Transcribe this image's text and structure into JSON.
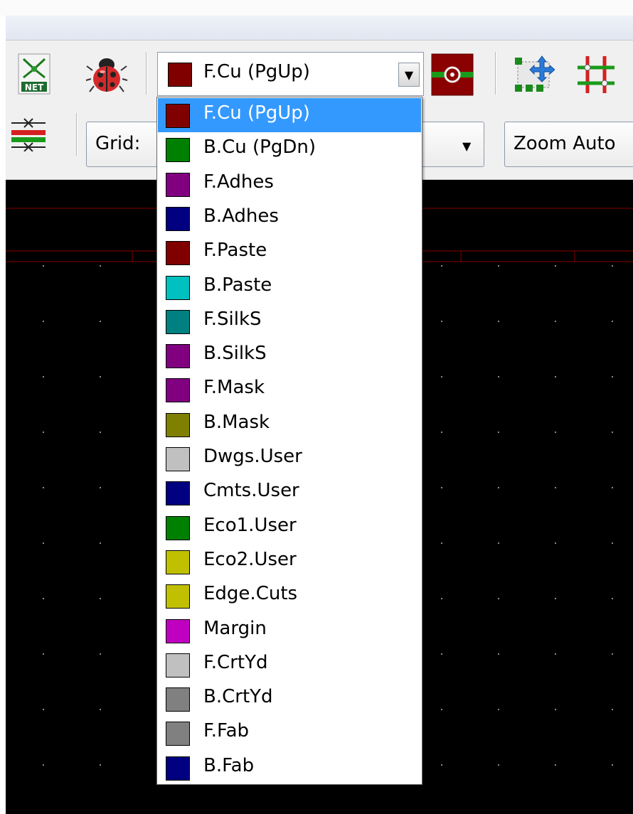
{
  "toolbar": {
    "layer_selector": {
      "value": "F.Cu (PgUp)",
      "swatch": "#800000"
    },
    "grid_label": "Grid:",
    "zoom_label": "Zoom Auto"
  },
  "icons": {
    "net": "NET",
    "netlist_icon": "netlist-icon",
    "drc_icon": "ladybug-drc-icon",
    "via_icon": "via-layer-pair-icon",
    "footprint_icon": "footprint-move-icon",
    "track_icon": "track-icon",
    "microwave_icon": "microwave-tool-icon"
  },
  "layers": [
    {
      "label": "F.Cu (PgUp)",
      "color": "#800000",
      "selected": true
    },
    {
      "label": "B.Cu (PgDn)",
      "color": "#008000"
    },
    {
      "label": "F.Adhes",
      "color": "#800080"
    },
    {
      "label": "B.Adhes",
      "color": "#000080"
    },
    {
      "label": "F.Paste",
      "color": "#800000"
    },
    {
      "label": "B.Paste",
      "color": "#00c0c0"
    },
    {
      "label": "F.SilkS",
      "color": "#008080"
    },
    {
      "label": "B.SilkS",
      "color": "#800080"
    },
    {
      "label": "F.Mask",
      "color": "#800080"
    },
    {
      "label": "B.Mask",
      "color": "#808000"
    },
    {
      "label": "Dwgs.User",
      "color": "#c0c0c0"
    },
    {
      "label": "Cmts.User",
      "color": "#000080"
    },
    {
      "label": "Eco1.User",
      "color": "#008000"
    },
    {
      "label": "Eco2.User",
      "color": "#c0c000"
    },
    {
      "label": "Edge.Cuts",
      "color": "#c0c000"
    },
    {
      "label": "Margin",
      "color": "#c000c0"
    },
    {
      "label": "F.CrtYd",
      "color": "#c0c0c0"
    },
    {
      "label": "B.CrtYd",
      "color": "#808080"
    },
    {
      "label": "F.Fab",
      "color": "#808080"
    },
    {
      "label": "B.Fab",
      "color": "#000080"
    }
  ],
  "canvas": {
    "background": "#000000",
    "grid_color": "#8a8a8a",
    "border_color": "#840000"
  }
}
